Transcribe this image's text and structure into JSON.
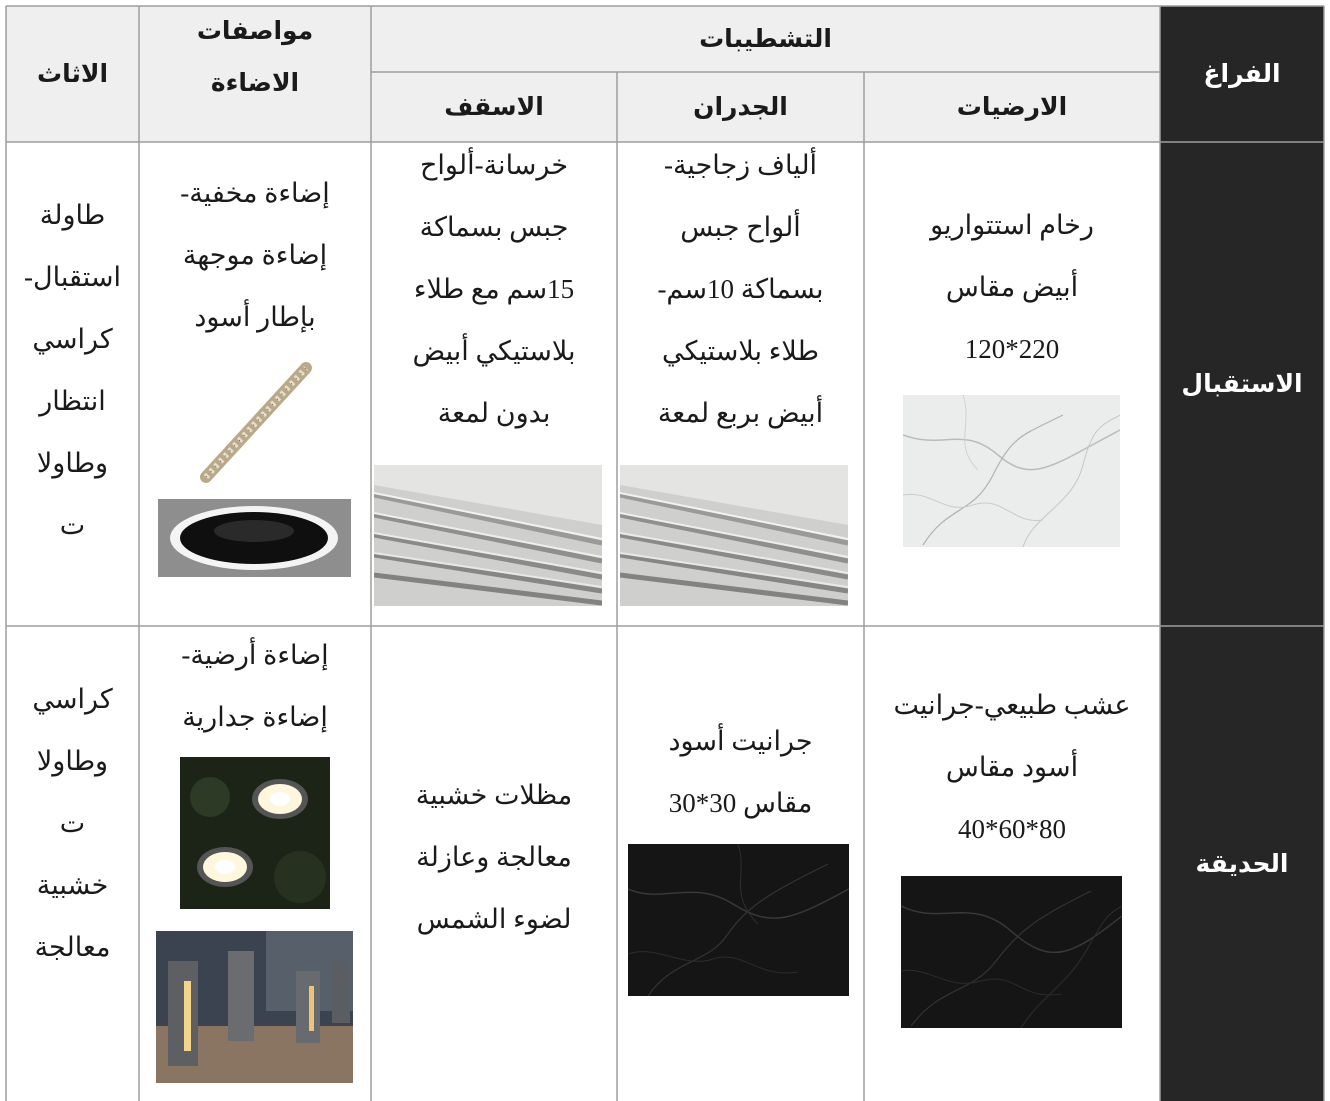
{
  "table": {
    "headers": {
      "space": "الفراغ",
      "finishes": "التشطيبات",
      "floors": "الارضيات",
      "walls": "الجدران",
      "ceilings": "الاسقف",
      "lighting_line1": "مواصفات",
      "lighting_line2": "الاضاءة",
      "furniture": "الاثاث"
    },
    "rows": [
      {
        "space": "الاستقبال",
        "floors": [
          "رخام استتواريو",
          "أبيض مقاس",
          "220*120"
        ],
        "walls": [
          "ألياف زجاجية-",
          "ألواح جبس",
          "بسماكة 10سم-",
          "طلاء بلاستيكي",
          "أبيض بربع لمعة"
        ],
        "ceilings": [
          "خرسانة-ألواح",
          "جبس بسماكة",
          "15سم مع طلاء",
          "بلاستيكي أبيض",
          "بدون لمعة"
        ],
        "lighting": [
          "إضاءة مخفية-",
          "إضاءة موجهة",
          "بإطار أسود"
        ],
        "furniture": [
          "طاولة",
          "استقبال-",
          "كراسي",
          "انتظار",
          "وطاولا",
          "ت"
        ]
      },
      {
        "space": "الحديقة",
        "floors": [
          "عشب طبيعي-جرانيت",
          "أسود مقاس",
          "80*60*40"
        ],
        "walls": [
          "جرانيت أسود",
          "مقاس 30*30"
        ],
        "ceilings": [
          "مظلات خشبية",
          "معالجة وعازلة",
          "لضوء الشمس"
        ],
        "lighting": [
          "إضاءة أرضية-",
          "إضاءة جدارية"
        ],
        "furniture": [
          "كراسي",
          "وطاولا",
          "ت",
          "خشبية",
          "معالجة"
        ]
      }
    ]
  },
  "colors": {
    "header_bg": "#efefef",
    "space_column_bg": "#262626",
    "border": "#9e9e9e"
  },
  "images": {
    "reception_floor": "white-marble-photo",
    "reception_walls": "gypsum-board-stack-photo",
    "reception_ceiling": "gypsum-board-stack-photo",
    "reception_light_strip": "led-strip-photo",
    "reception_downlight": "black-downlight-photo",
    "garden_floor": "black-granite-photo",
    "garden_walls": "black-granite-photo",
    "garden_ground_light": "ground-light-photo",
    "garden_bollard_light": "bollard-light-photo"
  }
}
